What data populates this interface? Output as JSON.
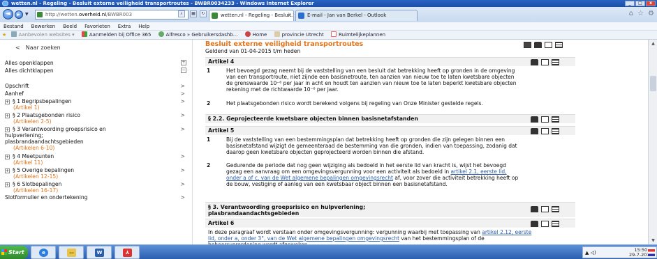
{
  "window": {
    "title": "wetten.nl - Regeling - Besluit externe veiligheid transportroutes - BWBR0034233 - Windows Internet Explorer",
    "controls": [
      "_",
      "□",
      "x"
    ]
  },
  "browser": {
    "address_prefix": "http://wetten.",
    "address_domain": "overheid.nl",
    "address_suffix": "/BWBR003",
    "tabs": [
      {
        "label": "wetten.nl - Regeling - Besluit...",
        "close": "×"
      },
      {
        "label": "E-mail - Jan van Berkel - Outlook"
      }
    ],
    "right_tools": [
      "⌂",
      "☆",
      "⚙"
    ]
  },
  "menubar": [
    "Bestand",
    "Bewerken",
    "Beeld",
    "Favorieten",
    "Extra",
    "Help"
  ],
  "favorites": [
    {
      "label": "Aanbevolen websites ▾",
      "muted": true,
      "color": "#8aa"
    },
    {
      "label": "Aanmelden bij Office 365",
      "color": "#e44"
    },
    {
      "label": "Alfresco » Gebruikersdashb...",
      "color": "#6a6"
    },
    {
      "label": "Home",
      "color": "#c44"
    },
    {
      "label": "provincie Utrecht",
      "color": "#dca"
    },
    {
      "label": "Ruimtelijkeplannen",
      "color": "#e66"
    }
  ],
  "sidebar": {
    "back": "Naar zoeken",
    "expand_all": "Alles openklappen",
    "collapse_all": "Alles dichtklappen",
    "items": [
      {
        "label": "Opschrift"
      },
      {
        "label": "Aanhef"
      },
      {
        "label": "§ 1  Begripsbepalingen",
        "sub": "(Artikel 1)"
      },
      {
        "label": "§ 2  Plaatsgebonden risico",
        "sub": "(Artikelen 2-5)"
      },
      {
        "label": "§ 3  Verantwoording groepsrisico en",
        "label2": "hulpverlening;",
        "label3": "plasbrandaandachtsgebieden",
        "sub": "(Artikelen 6-10)"
      },
      {
        "label": "§ 4  Meetpunten",
        "sub": "(Artikel 11)"
      },
      {
        "label": "§ 5  Overige bepalingen",
        "sub": "(Artikelen 12-15)"
      },
      {
        "label": "§ 6  Slotbepalingen",
        "sub": "(Artikelen 16-17)"
      },
      {
        "label": "Slotformulier en ondertekening"
      }
    ]
  },
  "document": {
    "title": "Besluit externe veiligheid transportroutes",
    "valid": "Geldend van 01-04-2015 t/m heden",
    "art4": {
      "heading": "Artikel 4",
      "p1_num": "1",
      "p1": "Het bevoegd gezag neemt bij de vaststelling van een besluit dat betrekking heeft op gronden in de omgeving van een transportroute, niet zijnde een basisnetroute, ten aanzien van nieuw toe te laten kwetsbare objecten de grenswaarde 10⁻⁶ per jaar in acht en houdt ten aanzien van nieuw toe te laten beperkt kwetsbare objecten rekening met de richtwaarde 10⁻⁶ per jaar.",
      "p2_num": "2",
      "p2": "Het plaatsgebonden risico wordt berekend volgens bij regeling van Onze Minister gestelde regels."
    },
    "sec22": "§ 2.2. Geprojecteerde kwetsbare objecten binnen basisnetafstanden",
    "art5": {
      "heading": "Artikel 5",
      "p1_num": "1",
      "p1": "Bij de vaststelling van een bestemmingsplan dat betrekking heeft op gronden die zijn gelegen binnen een basisnetafstand wijzigt de gemeenteraad de bestemming van die gronden, indien van toepassing, zodanig dat daarop geen kwetsbare objecten geprojecteerd worden binnen die afstand.",
      "p2_num": "2",
      "p2_a": "Gedurende de periode dat nog geen wijziging als bedoeld in het eerste lid van kracht is, wijst het bevoegd gezag een aanvraag om een omgevingsvergunning voor een activiteit als bedoeld in ",
      "p2_link": "artikel 2.1, eerste lid, onder a of c, van de Wet algemene bepalingen omgevingsrecht",
      "p2_b": " af, voor zover die activiteit betrekking heeft op de bouw, vestiging of aanleg van een kwetsbaar object binnen een basisnetafstand."
    },
    "sec3_line1": "§ 3. Verantwoording groepsrisico en hulpverlening;",
    "sec3_line2": "plasbrandaandachtsgebieden",
    "art6": {
      "heading": "Artikel 6",
      "t_a": "In deze paragraaf wordt verstaan onder omgevingsvergunning: vergunning waarbij met toepassing van ",
      "t_link": "artikel 2.12, eerste lid, onder a, onder 3°, van de Wet algemene bepalingen omgevingsrecht",
      "t_b": " van het bestemmingsplan of de beheersverordening wordt afgeweken."
    }
  },
  "taskbar": {
    "start": "Start",
    "apps": [
      {
        "name": "ie",
        "color": "#2a7de1",
        "glyph": "e"
      },
      {
        "name": "explorer",
        "color": "#e8c44a",
        "glyph": "▭"
      },
      {
        "name": "word",
        "color": "#2b5fb0",
        "glyph": "W"
      },
      {
        "name": "pdf",
        "color": "#d33",
        "glyph": "⅄"
      }
    ],
    "tray_left": "▲ ◁)",
    "time": "15:50",
    "date": "29-7-2016"
  }
}
